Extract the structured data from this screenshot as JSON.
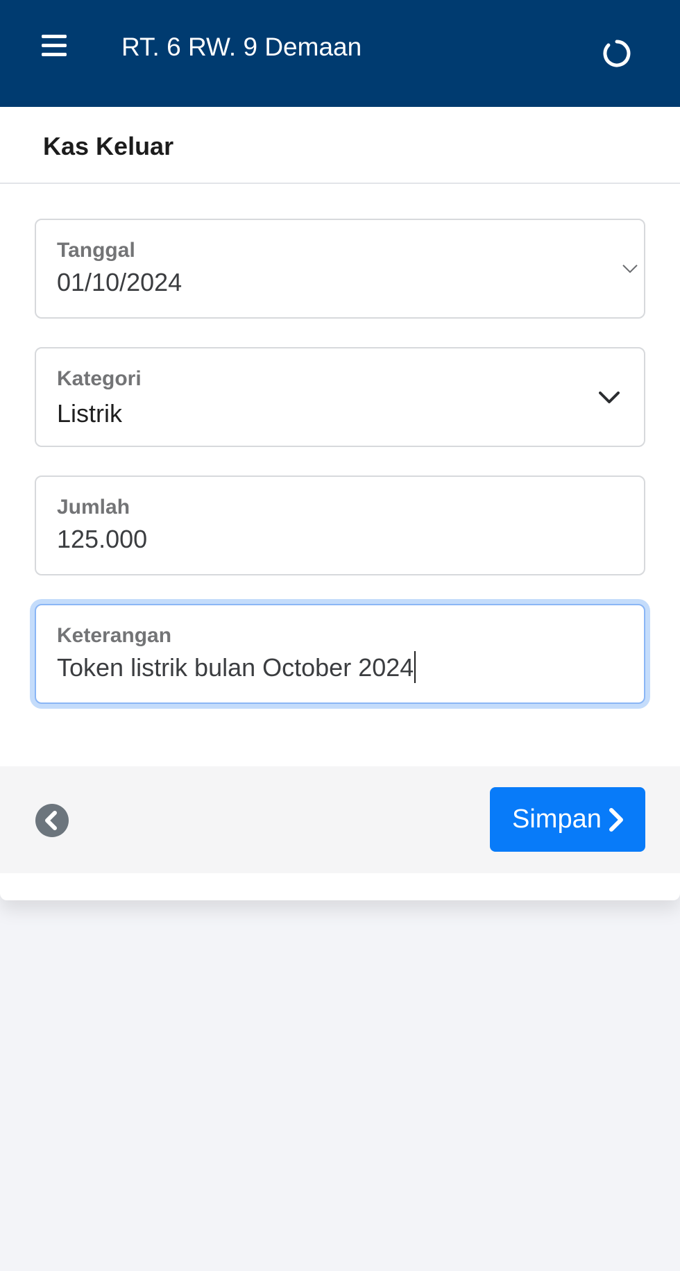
{
  "app": {
    "title": "RT. 6 RW. 9 Demaan",
    "menu_icon": "hamburger-menu-icon",
    "refresh_icon": "refresh-icon"
  },
  "page": {
    "title": "Kas Keluar"
  },
  "form": {
    "tanggal": {
      "label": "Tanggal",
      "value": "01/10/2024"
    },
    "kategori": {
      "label": "Kategori",
      "value": "Listrik"
    },
    "jumlah": {
      "label": "Jumlah",
      "value": "125.000"
    },
    "keterangan": {
      "label": "Keterangan",
      "value": "Token listrik bulan October 2024"
    }
  },
  "footer": {
    "back_icon": "chevron-left-circle-icon",
    "save_label": "Simpan",
    "save_icon": "chevron-right-icon"
  },
  "colors": {
    "header_bg": "#003b70",
    "primary": "#087bf9",
    "page_bg": "#f3f4f8",
    "focus_ring": "#c4dcfb"
  }
}
